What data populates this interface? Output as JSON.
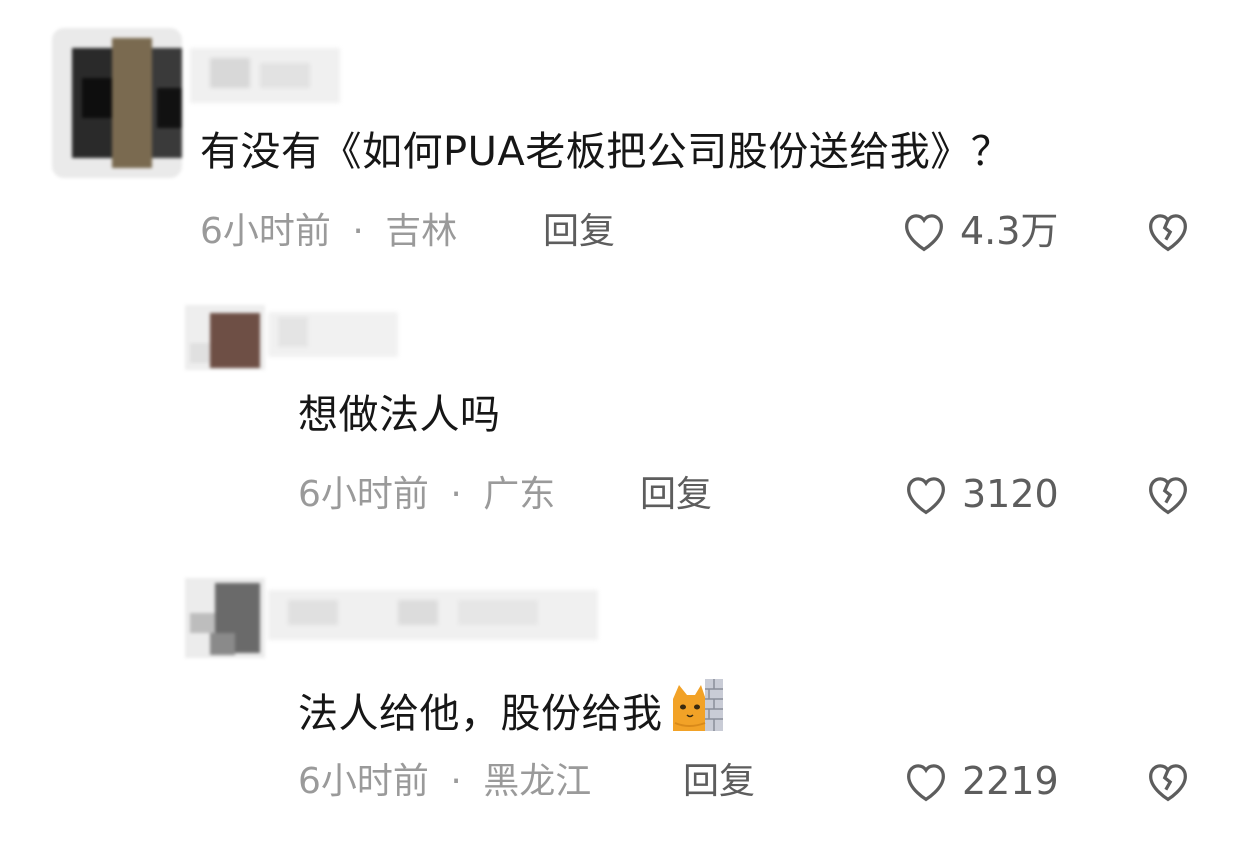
{
  "comments": [
    {
      "text": "有没有《如何PUA老板把公司股份送给我》？",
      "time": "6小时前",
      "location": "吉林",
      "reply_label": "回复",
      "likes": "4.3万"
    },
    {
      "text": "想做法人吗",
      "time": "6小时前",
      "location": "广东",
      "reply_label": "回复",
      "likes": "3120"
    },
    {
      "text": "法人给他，股份给我",
      "emoji": "cat-behind-wall-emoji",
      "time": "6小时前",
      "location": "黑龙江",
      "reply_label": "回复",
      "likes": "2219"
    }
  ],
  "separator": "·",
  "colors": {
    "text": "#161616",
    "meta": "#9a9a9a",
    "action": "#5d5d5d"
  }
}
